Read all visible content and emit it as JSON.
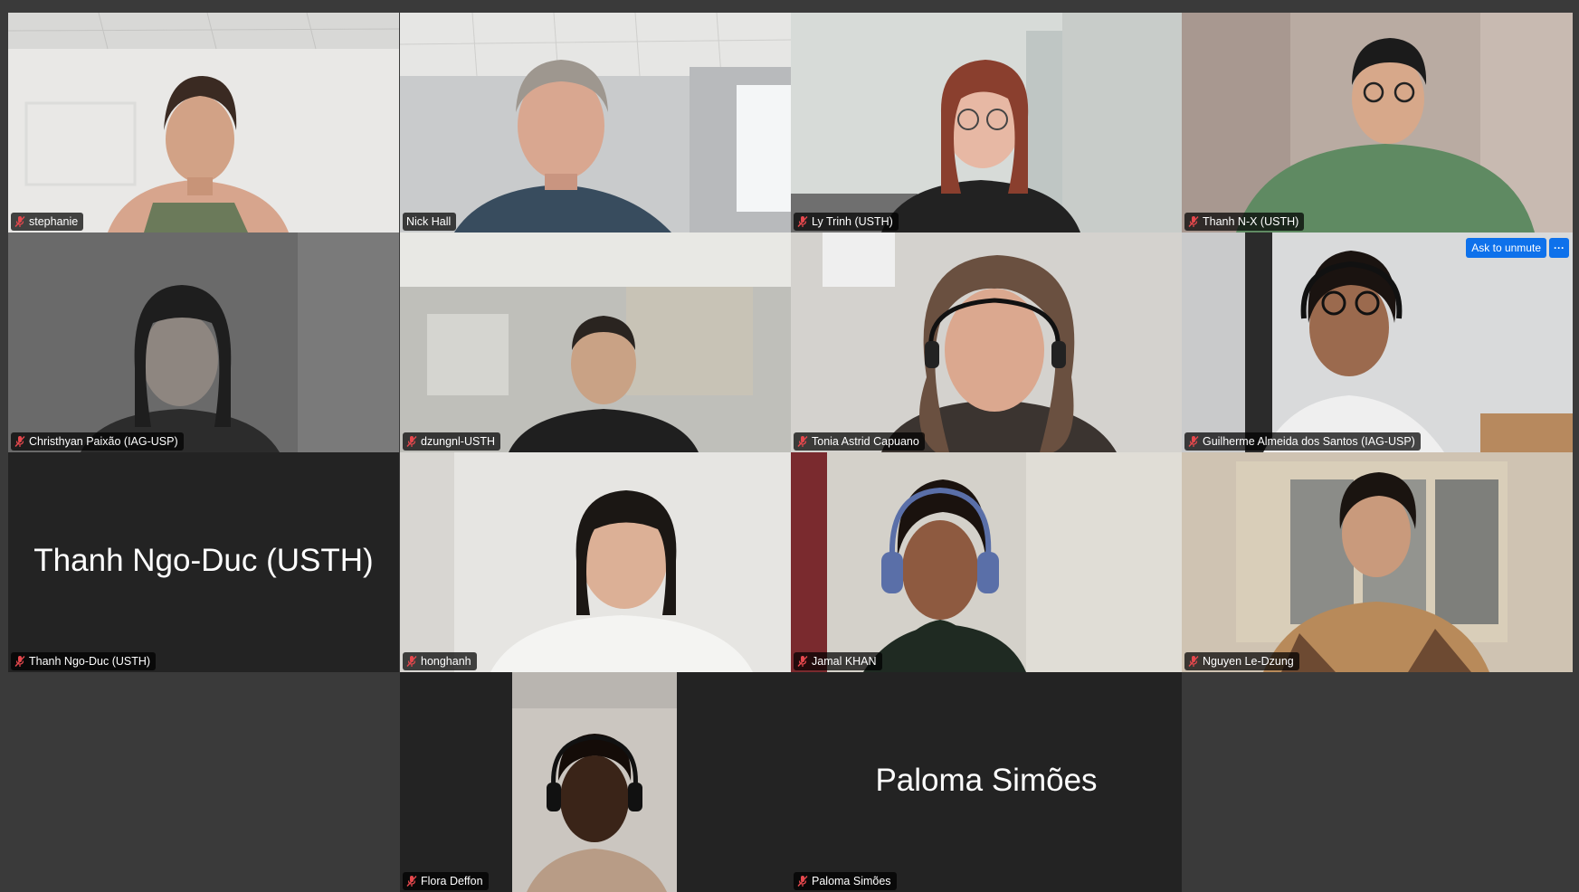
{
  "gallery": {
    "participants": [
      {
        "name": "stephanie",
        "muted": true
      },
      {
        "name": "Nick Hall",
        "muted": false,
        "speaking": true
      },
      {
        "name": "Ly Trinh (USTH)",
        "muted": true
      },
      {
        "name": "Thanh N-X (USTH)",
        "muted": true
      },
      {
        "name": "Christhyan Paixão (IAG-USP)",
        "muted": true
      },
      {
        "name": "dzungnl-USTH",
        "muted": true
      },
      {
        "name": "Tonia Astrid Capuano",
        "muted": true
      },
      {
        "name": "Guilherme Almeida dos Santos (IAG-USP)",
        "muted": true
      },
      {
        "name": "Thanh Ngo-Duc (USTH)",
        "muted": true,
        "video_off": true,
        "display_name": "Thanh Ngo-Duc (USTH)"
      },
      {
        "name": "honghanh",
        "muted": true
      },
      {
        "name": "Jamal KHAN",
        "muted": true
      },
      {
        "name": "Nguyen Le-Dzung",
        "muted": true
      },
      {
        "name": "Flora Deffon",
        "muted": true
      },
      {
        "name": "Paloma Simões",
        "muted": true,
        "video_off": true,
        "display_name": "Paloma Simões"
      }
    ],
    "hover": {
      "ask_to_unmute_label": "Ask to unmute",
      "more_label": "···"
    }
  },
  "colors": {
    "background": "#3a3a3a",
    "tile_off": "#232323",
    "active_speaker_border": "#2ecc40",
    "accent_button": "#0e71eb",
    "muted_mic": "#e5484d"
  },
  "icons": {
    "muted": "muted-mic-icon",
    "more": "more-options-icon"
  }
}
